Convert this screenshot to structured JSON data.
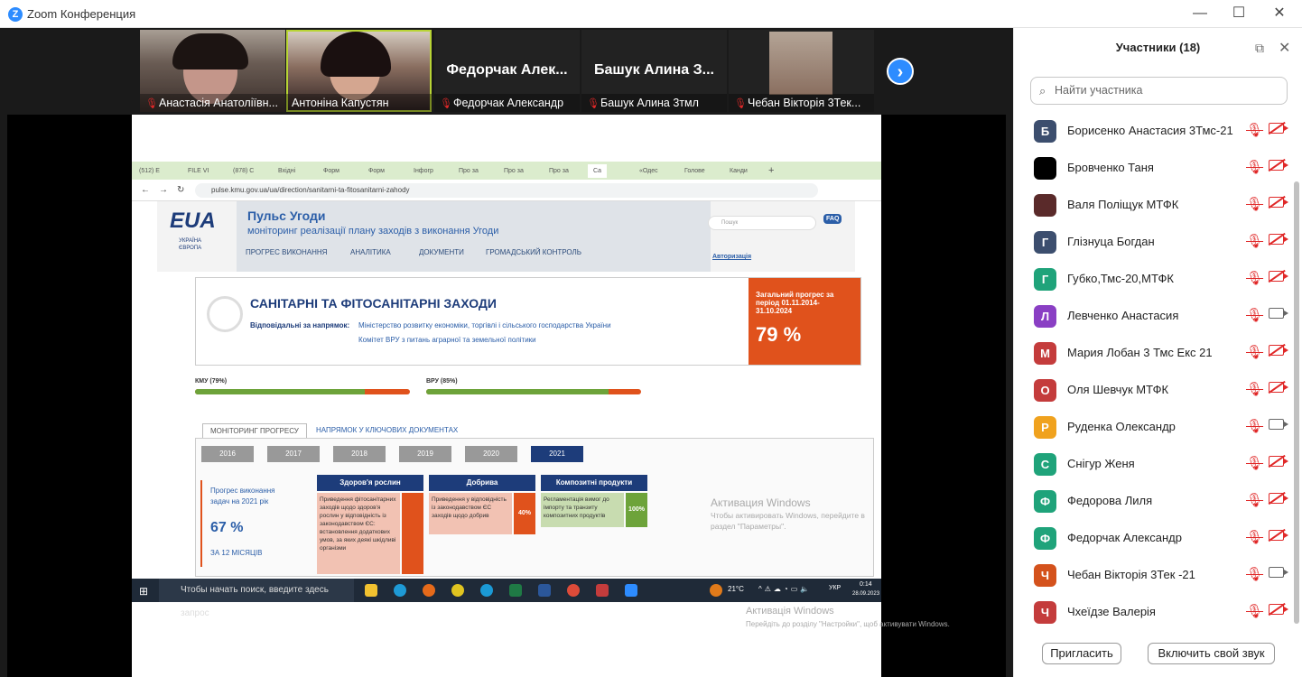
{
  "window": {
    "title": "Zoom Конференция"
  },
  "video_tiles": [
    {
      "name": "Анастасія Анатоліївн..."
    },
    {
      "name": "Антоніна Капустян"
    },
    {
      "display": "Федорчак Алек...",
      "name": "Федорчак Александр"
    },
    {
      "display": "Башук Алина З...",
      "name": "Башук Алина 3тмл"
    },
    {
      "name": "Чебан  Вікторія 3Тек..."
    }
  ],
  "browser": {
    "tabs": [
      "(512) E",
      "FILE VI",
      "(878) C",
      "Вхідні",
      "Форм",
      "Форм",
      "Інфогр",
      "Про за",
      "Про за",
      "Про за",
      "Са",
      "«Одес",
      "Голове",
      "Канди"
    ],
    "url": "pulse.kmu.gov.ua/ua/direction/sanitarni-ta-fitosanitarni-zahody"
  },
  "site": {
    "logo_text": "EUA",
    "logo_sub1": "УКРАЇНА",
    "logo_sub2": "ЄВРОПА",
    "title": "Пульс Угоди",
    "subtitle": "моніторинг реалізації плану заходів з виконання Угоди",
    "nav": [
      "ПРОГРЕС ВИКОНАННЯ",
      "АНАЛІТИКА",
      "ДОКУМЕНТИ",
      "ГРОМАДСЬКИЙ КОНТРОЛЬ"
    ],
    "search_placeholder": "Пошук",
    "faq": "FAQ",
    "auth": "Авторизація",
    "banner_title": "САНІТАРНІ ТА ФІТОСАНІТАРНІ ЗАХОДИ",
    "responsible_label": "Відповідальні за напрямок:",
    "responsible_1": "Міністерство розвитку економіки, торгівлі і сільського господарства України",
    "responsible_2": "Комітет ВРУ з питань аграрної та земельної політики",
    "overall_label": "Загальний прогрес за період 01.11.2014-31.10.2024",
    "overall_value": "79 %",
    "kmu_label": "КМУ (79%)",
    "kmu_progress": 0.79,
    "vru_label": "ВРУ (85%)",
    "vru_progress": 0.85,
    "tab_active": "МОНІТОРИНГ ПРОГРЕСУ",
    "tab_other": "НАПРЯМОК У КЛЮЧОВИХ ДОКУМЕНТАХ",
    "years": [
      "2016",
      "2017",
      "2018",
      "2019",
      "2020",
      "2021"
    ],
    "progress_label": "Прогрес виконання задач на 2021 рік",
    "progress_value": "67 %",
    "progress_sub": "ЗА 12 МІСЯЦІВ",
    "cards": [
      {
        "title": "Здоров'я рослин",
        "text": "Приведення фітосанітарних заходів щодо здоров'я рослин у відповідність із законодавством ЄС: встановлення додаткових умов, за яких деякі шкідливі організми"
      },
      {
        "title": "Добрива",
        "text": "Приведення у відповідність із законодавством ЄС заходів щодо добрив",
        "pct": "40%"
      },
      {
        "title": "Композитні продукти",
        "text": "Регламентація вимог до імпорту та транзиту композитних продуктів",
        "pct": "100%"
      }
    ],
    "activation_title": "Активация Windows",
    "activation_text_1": "Чтобы активировать Windows, перейдите в",
    "activation_text_2": "раздел \"Параметры\"."
  },
  "taskbar": {
    "search": "Чтобы начать поиск, введите здесь запрос",
    "weather": "21°C",
    "lang": "УКР",
    "time": "0:14",
    "date": "28.09.2023"
  },
  "outer_activation": {
    "title": "Активація Windows",
    "text": "Перейдіть до розділу \"Настройки\", щоб активувати Windows."
  },
  "participants_panel": {
    "title": "Участники (18)",
    "search_placeholder": "Найти участника",
    "invite": "Пригласить",
    "unmute": "Включить свой звук",
    "participants": [
      {
        "initial": "Б",
        "name": "Борисенко Анастасия 3Тмс-21",
        "color": "#3c4e6e",
        "cam": "off"
      },
      {
        "initial": "",
        "name": "Бровченко Таня",
        "color": "#000000",
        "cam": "off"
      },
      {
        "initial": "",
        "name": "Валя Поліщук МТФК",
        "color": "#5a2a2a",
        "cam": "off"
      },
      {
        "initial": "Г",
        "name": "Глізнуца Богдан",
        "color": "#3c4e6e",
        "cam": "off"
      },
      {
        "initial": "Г",
        "name": "Губко,Тмс-20,МТФК",
        "color": "#1fa37a",
        "cam": "off"
      },
      {
        "initial": "Л",
        "name": "Левченко Анастасия",
        "color": "#8a3fc4",
        "cam": "on"
      },
      {
        "initial": "М",
        "name": "Мария Лобан 3 Тмс Екс 21",
        "color": "#c43c3c",
        "cam": "off"
      },
      {
        "initial": "О",
        "name": "Оля Шевчук МТФК",
        "color": "#c43c3c",
        "cam": "off"
      },
      {
        "initial": "Р",
        "name": "Руденка Олександр",
        "color": "#f0a21e",
        "cam": "on"
      },
      {
        "initial": "С",
        "name": "Снігур Женя",
        "color": "#1fa37a",
        "cam": "off"
      },
      {
        "initial": "Ф",
        "name": "Федорова Лиля",
        "color": "#1fa37a",
        "cam": "off"
      },
      {
        "initial": "Ф",
        "name": "Федорчак Александр",
        "color": "#1fa37a",
        "cam": "off"
      },
      {
        "initial": "Ч",
        "name": "Чебан  Вікторія 3Тек -21",
        "color": "#d4521c",
        "cam": "on"
      },
      {
        "initial": "Ч",
        "name": "Чхеїдзе Валерія",
        "color": "#c43c3c",
        "cam": "off"
      }
    ]
  }
}
